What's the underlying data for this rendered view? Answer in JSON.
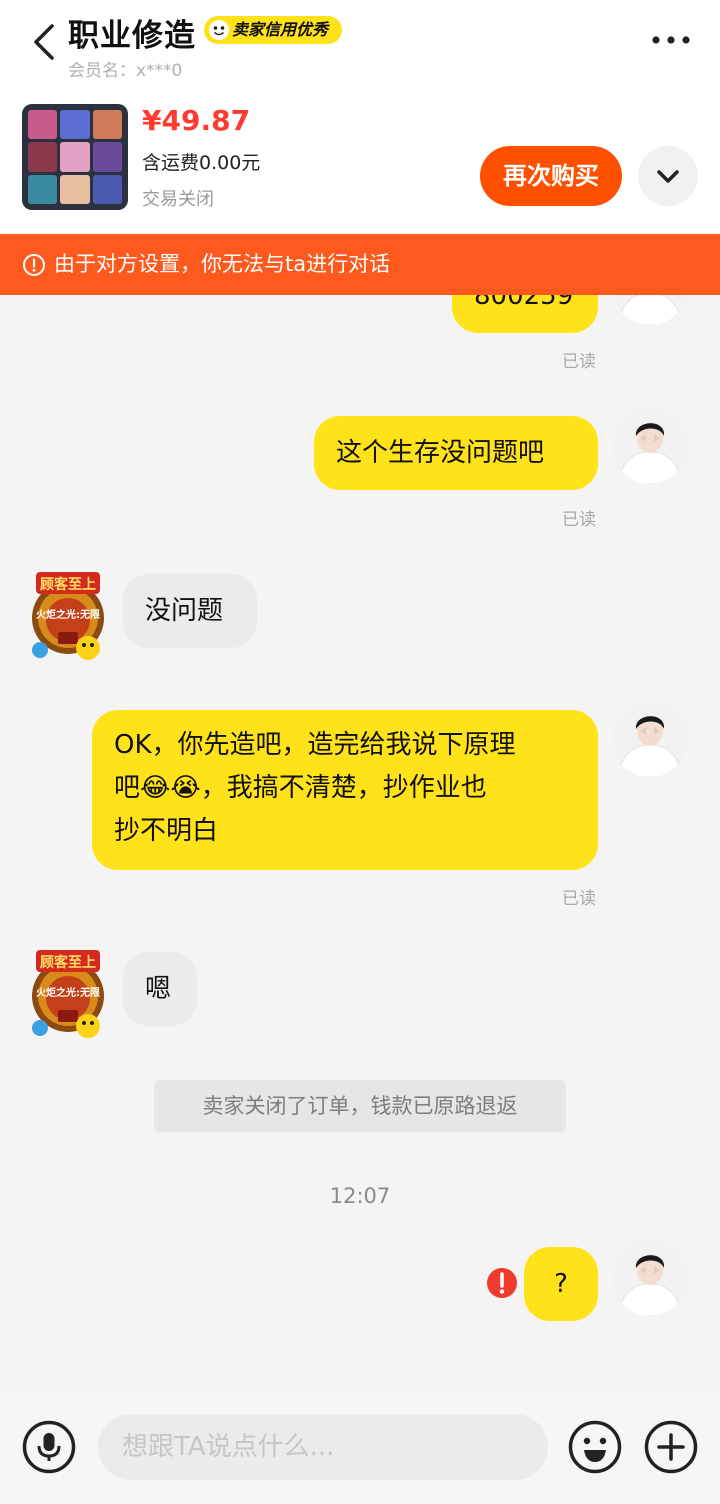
{
  "header": {
    "title": "职业修造",
    "badge": "卖家信用优秀",
    "member_label": "会员名：x***0",
    "back_icon": "chevron-left-icon",
    "more_icon": "more-dots-icon"
  },
  "order": {
    "price": "¥49.87",
    "shipping": "含运费0.00元",
    "status": "交易关闭",
    "buy_again_label": "再次购买",
    "expand_icon": "chevron-down-icon"
  },
  "notice": {
    "text": "由于对方设置，你无法与ta进行对话",
    "icon": "alert-circle-icon"
  },
  "messages": [
    {
      "from": "me",
      "text": "800259",
      "read_label": "已读"
    },
    {
      "from": "me",
      "text": "这个生存没问题吧",
      "read_label": "已读"
    },
    {
      "from": "them",
      "text": "没问题"
    },
    {
      "from": "me",
      "line1": "OK，你先造吧，造完给我说下原理",
      "line2_before": "吧",
      "line2_emoji1": "😂",
      "line2_emoji2": "😭",
      "line2_after": "，我搞不清楚，抄作业也",
      "line3": "抄不明白",
      "read_label": "已读"
    },
    {
      "from": "them",
      "text": "嗯"
    },
    {
      "from": "me",
      "text": "?",
      "failed": true
    }
  ],
  "system_message": "卖家关闭了订单，钱款已原路退返",
  "timestamp": "12:07",
  "avatar_text": {
    "banner": "顾客至上",
    "center": "火炬之光:无限"
  },
  "composer": {
    "placeholder": "想跟TA说点什么...",
    "mic_icon": "microphone-icon",
    "emoji_icon": "emoji-icon",
    "plus_icon": "plus-icon"
  },
  "colors": {
    "accent": "#ff5000",
    "notice_bg": "#ff5a1e",
    "my_bubble": "#ffe21a",
    "their_bubble": "#ebebeb",
    "price": "#ff3b30"
  }
}
